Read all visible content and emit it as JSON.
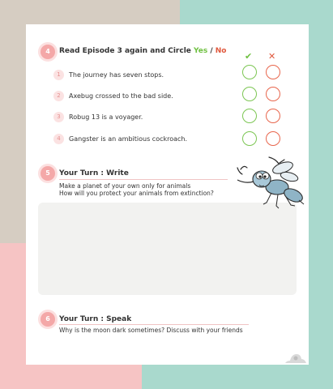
{
  "section4": {
    "number": "4",
    "title": "Read Episode 3 again and Circle ",
    "yes": "Yes",
    "sep": " / ",
    "no": "No",
    "check_mark": "✔",
    "cross_mark": "✕",
    "items": [
      {
        "n": "1",
        "text": "The journey has seven stops."
      },
      {
        "n": "2",
        "text": "Axebug  crossed to the bad side."
      },
      {
        "n": "3",
        "text": "Robug 13 is a voyager."
      },
      {
        "n": "4",
        "text": "Gangster is an ambitious cockroach."
      }
    ]
  },
  "section5": {
    "number": "5",
    "title": "Your Turn : Write",
    "line1": "Make a planet of your own only for animals",
    "line2": "How will you protect your animals from extinction?"
  },
  "section6": {
    "number": "6",
    "title": "Your Turn : Speak",
    "line1": "Why is the moon dark sometimes? Discuss with your friends"
  },
  "icons": {
    "bug": "mosquito-illustration-icon",
    "logo": "publisher-logo-icon"
  }
}
